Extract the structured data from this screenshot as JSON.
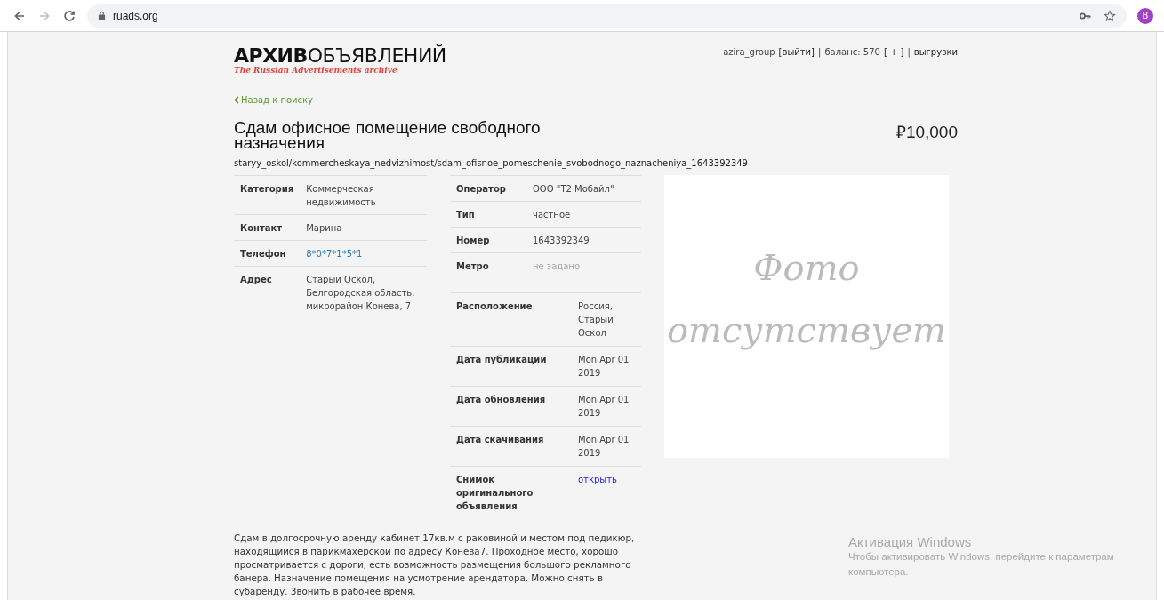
{
  "browser": {
    "nav": [
      {
        "kind": "back",
        "disabled": false
      },
      {
        "kind": "forward",
        "disabled": true
      },
      {
        "kind": "reload",
        "disabled": false
      }
    ],
    "url": "ruads.org",
    "profile": "B"
  },
  "header": {
    "logo_bold": "АРХИВ",
    "logo_rest": "ОБЪЯВЛЕНИЙ",
    "tagline": "The Russian Advertisements archive",
    "user_links": [
      {
        "kind": "text",
        "text": "azira_group"
      },
      {
        "kind": "link",
        "text": "[выйти]"
      },
      {
        "kind": "text",
        "text": "|"
      },
      {
        "kind": "text",
        "text": "баланс: 570"
      },
      {
        "kind": "link",
        "text": "[ + ]"
      },
      {
        "kind": "text",
        "text": "|"
      },
      {
        "kind": "link",
        "text": "выгрузки"
      }
    ]
  },
  "back_link": "Назад к поиску",
  "title": "Сдам офисное помещение свободного назначения",
  "price": "₽10,000",
  "path": "staryy_oskol/kommercheskaya_nedvizhimost/sdam_ofisnoe_pomeschenie_svobodnogo_naznacheniya_1643392349",
  "details_left": [
    {
      "label": "Категория",
      "value": "Коммерческая недвижимость",
      "kind": "text"
    },
    {
      "label": "Контакт",
      "value": "Марина",
      "kind": "text"
    },
    {
      "label": "Телефон",
      "value": "8*0*7*1*5*1",
      "kind": "phone"
    },
    {
      "label": "Адрес",
      "value": "Старый Оскол, Белгородская область, микрорайон Конева, 7",
      "kind": "text"
    }
  ],
  "details_operator": [
    {
      "label": "Оператор",
      "value": "ООО \"Т2 Мобайл\"",
      "kind": "text"
    },
    {
      "label": "Тип",
      "value": "частное",
      "kind": "text"
    },
    {
      "label": "Номер",
      "value": "1643392349",
      "kind": "text"
    },
    {
      "label": "Метро",
      "value": "не задано",
      "kind": "empty"
    }
  ],
  "details_meta": [
    {
      "label": "Расположение",
      "value": "Россия, Старый Оскол",
      "kind": "text"
    },
    {
      "label": "Дата публикации",
      "value": "Mon Apr 01 2019",
      "kind": "text"
    },
    {
      "label": "Дата обновления",
      "value": "Mon Apr 01 2019",
      "kind": "text"
    },
    {
      "label": "Дата скачивания",
      "value": "Mon Apr 01 2019",
      "kind": "text"
    },
    {
      "label": "Снимок оригинального объявления",
      "value": "открыть",
      "kind": "link"
    }
  ],
  "photo_placeholder": [
    "Фото",
    "отсутствует"
  ],
  "description": "Сдам в долгосрочную аренду кабинет 17кв.м с раковиной и местом под педикюр, находящийся в парикмахерской по адресу Конева7. Проходное место, хорошо просматривается с дороги, есть возможность размещения большого рекламного банера. Назначение помещения на усмотрение арендатора. Можно снять в субаренду. Звонить в рабочее время.",
  "os_notice": {
    "title": "Активация Windows",
    "lines": [
      "Чтобы активировать Windows, перейдите к параметрам",
      "компьютера."
    ]
  }
}
